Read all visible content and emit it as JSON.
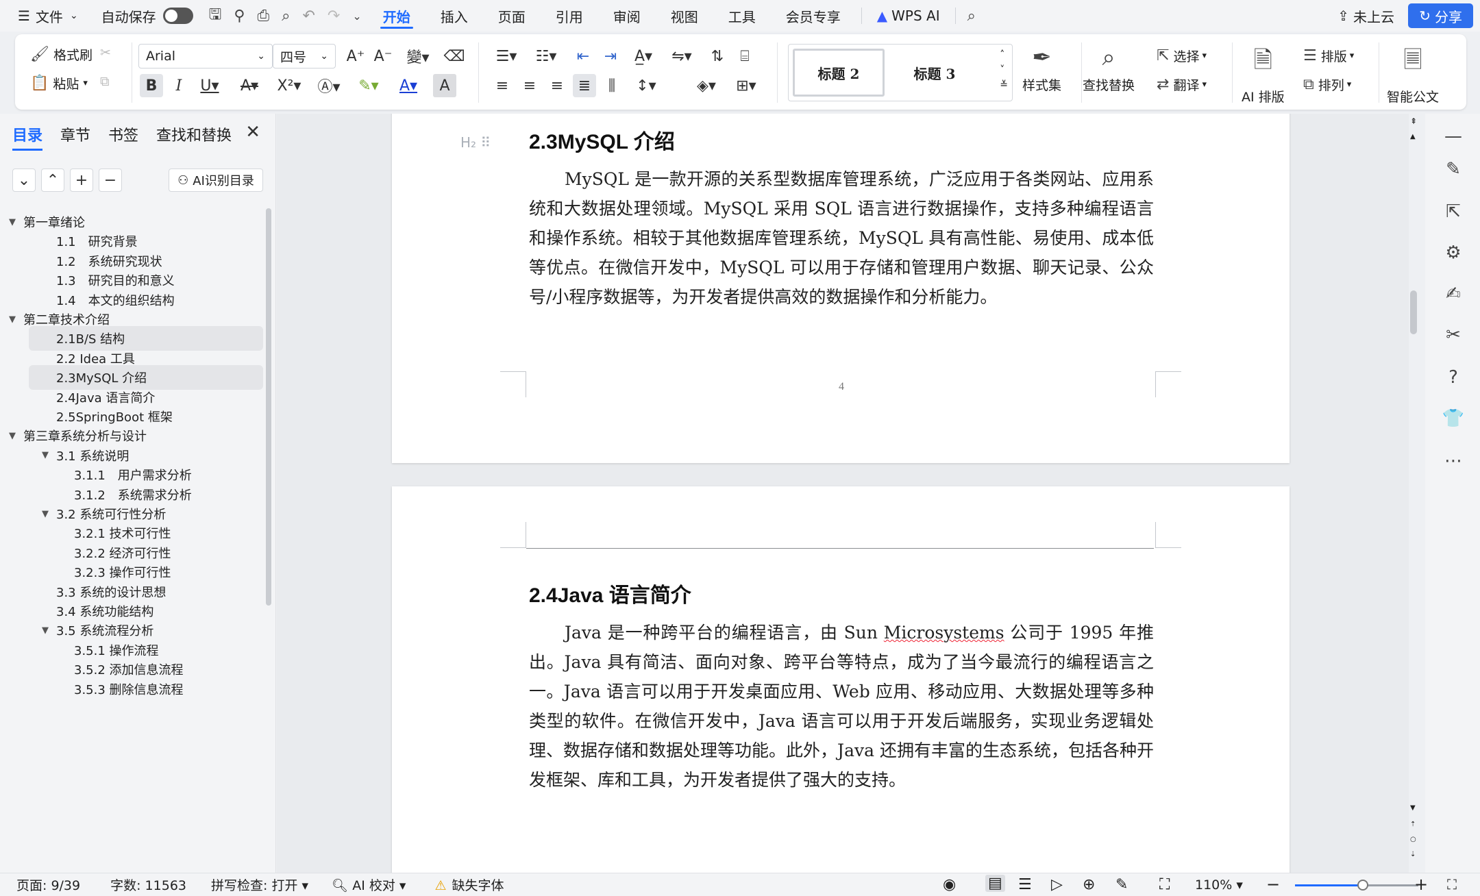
{
  "menubar": {
    "menu_icon": "☰",
    "file": "文件",
    "autosave": "自动保存",
    "tabs": [
      "开始",
      "插入",
      "页面",
      "引用",
      "审阅",
      "视图",
      "工具",
      "会员专享"
    ],
    "wps_ai": "WPS AI",
    "cloud": "未上云",
    "share": "分享"
  },
  "ribbon": {
    "format_painter": "格式刷",
    "paste": "粘贴",
    "font_name": "Arial",
    "font_size": "四号",
    "style_1": "标题 2",
    "style_2": "标题 3",
    "style_gallery": "样式集",
    "find_replace": "查找替换",
    "select": "选择",
    "translate": "翻译",
    "ai_layout": "AI 排版",
    "layout": "排版",
    "arrange": "排列",
    "smart_doc": "智能公文"
  },
  "nav": {
    "tabs": [
      "目录",
      "章节",
      "书签",
      "查找和替换"
    ],
    "ai_toc": "AI识别目录",
    "items": [
      {
        "label": "第一章绪论",
        "level": 0,
        "caret": "▼"
      },
      {
        "label": "1.1　研究背景",
        "level": 1,
        "caret": ""
      },
      {
        "label": "1.2　系统研究现状",
        "level": 1,
        "caret": ""
      },
      {
        "label": "1.3　研究目的和意义",
        "level": 1,
        "caret": ""
      },
      {
        "label": "1.4　本文的组织结构",
        "level": 1,
        "caret": ""
      },
      {
        "label": "第二章技术介绍",
        "level": 0,
        "caret": "▼"
      },
      {
        "label": "2.1B/S 结构",
        "level": 1,
        "caret": "",
        "hl": true
      },
      {
        "label": "2.2 Idea 工具",
        "level": 1,
        "caret": ""
      },
      {
        "label": "2.3MySQL 介绍",
        "level": 1,
        "caret": "",
        "hl": true
      },
      {
        "label": "2.4Java 语言简介",
        "level": 1,
        "caret": ""
      },
      {
        "label": "2.5SpringBoot 框架",
        "level": 1,
        "caret": ""
      },
      {
        "label": "第三章系统分析与设计",
        "level": 0,
        "caret": "▼"
      },
      {
        "label": "3.1 系统说明",
        "level": 1,
        "caret": "▼"
      },
      {
        "label": "3.1.1　用户需求分析",
        "level": 2,
        "caret": ""
      },
      {
        "label": "3.1.2　系统需求分析",
        "level": 2,
        "caret": ""
      },
      {
        "label": "3.2 系统可行性分析",
        "level": 1,
        "caret": "▼"
      },
      {
        "label": "3.2.1  技术可行性",
        "level": 2,
        "caret": ""
      },
      {
        "label": "3.2.2  经济可行性",
        "level": 2,
        "caret": ""
      },
      {
        "label": "3.2.3  操作可行性",
        "level": 2,
        "caret": ""
      },
      {
        "label": "3.3 系统的设计思想",
        "level": 1,
        "caret": ""
      },
      {
        "label": "3.4 系统功能结构",
        "level": 1,
        "caret": ""
      },
      {
        "label": "3.5 系统流程分析",
        "level": 1,
        "caret": "▼"
      },
      {
        "label": "3.5.1 操作流程",
        "level": 2,
        "caret": ""
      },
      {
        "label": "3.5.2 添加信息流程",
        "level": 2,
        "caret": ""
      },
      {
        "label": "3.5.3 删除信息流程",
        "level": 2,
        "caret": ""
      }
    ]
  },
  "doc": {
    "h1": "2.3MySQL 介绍",
    "p1": "MySQL 是一款开源的关系型数据库管理系统，广泛应用于各类网站、应用系统和大数据处理领域。MySQL 采用 SQL 语言进行数据操作，支持多种编程语言和操作系统。相较于其他数据库管理系统，MySQL 具有高性能、易使用、成本低等优点。在微信开发中，MySQL 可以用于存储和管理用户数据、聊天记录、公众号/小程序数据等，为开发者提供高效的数据操作和分析能力。",
    "page_number": "4",
    "h2": "2.4Java 语言简介",
    "p2_a": "Java 是一种跨平台的编程语言，由 Sun ",
    "p2_spell": "Microsystems",
    "p2_b": " 公司于 1995 年推出。Java 具有简洁、面向对象、跨平台等特点，成为了当今最流行的编程语言之一。Java 语言可以用于开发桌面应用、Web 应用、移动应用、大数据处理等多种类型的软件。在微信开发中，Java 语言可以用于开发后端服务，实现业务逻辑处理、数据存储和数据处理等功能。此外，Java 还拥有丰富的生态系统，包括各种开发框架、库和工具，为开发者提供了强大的支持。"
  },
  "status": {
    "page": "页面: 9/39",
    "words": "字数: 11563",
    "spell": "拼写检查: 打开",
    "ai_check": "AI 校对",
    "missing_font": "缺失字体",
    "zoom": "110%",
    "zoom_level": 0.55
  }
}
